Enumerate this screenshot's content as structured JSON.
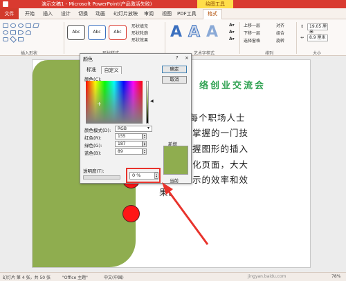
{
  "window": {
    "title": "演示文稿1 - Microsoft PowerPoint(产品激活失败)",
    "context_tab": "绘图工具"
  },
  "ribbon_tabs": [
    "文件",
    "开始",
    "插入",
    "设计",
    "切换",
    "动画",
    "幻灯片放映",
    "审阅",
    "视图",
    "PDF工具",
    "格式"
  ],
  "ribbon": {
    "shape_styles": [
      "Abc",
      "Abc",
      "Abc"
    ],
    "shape_commands": [
      "形状填充",
      "形状轮廓",
      "形状效果"
    ],
    "group_insert_shapes": "插入形状",
    "group_shape_styles": "形状样式",
    "group_art": "艺术字样式",
    "art_letters": [
      "A",
      "A",
      "A"
    ],
    "arrange_items": [
      "上移一层",
      "下移一层",
      "选择窗格",
      "对齐",
      "组合",
      "旋转"
    ],
    "group_arrange": "排列",
    "size_height": "19.05 厘米",
    "size_width": "8.9 厘米",
    "group_size": "大小"
  },
  "slide": {
    "title": "络创业交流会",
    "lines": [
      "是每个职场人士",
      "掌握的一门技",
      "握图形的插入",
      "化页面，大大",
      "示的效率和效",
      "果。"
    ]
  },
  "dialog": {
    "title": "颜色",
    "help": "?",
    "close": "×",
    "tab_standard": "标准",
    "tab_custom": "自定义",
    "colors_label": "颜色(C):",
    "ok": "确定",
    "cancel": "取消",
    "model_label": "颜色模式(D):",
    "model_value": "RGB",
    "red_label": "红色(R):",
    "red_value": "155",
    "green_label": "绿色(G):",
    "green_value": "187",
    "blue_label": "蓝色(B):",
    "blue_value": "89",
    "new_label": "新增",
    "current_label": "当前",
    "transparency_label": "透明度(T):",
    "transparency_value": "0 %"
  },
  "status": {
    "slide_info": "幻灯片 第 4 张，共 50 张",
    "theme": "\"Office 主题\"",
    "language": "中文(中国)",
    "zoom": "78%",
    "watermark": "jingyan.baidu.com"
  },
  "colors": {
    "accent_red": "#d93a30",
    "shape_green": "#8fad4f",
    "title_green": "#2ea150",
    "circle_red": "#ff1616"
  }
}
